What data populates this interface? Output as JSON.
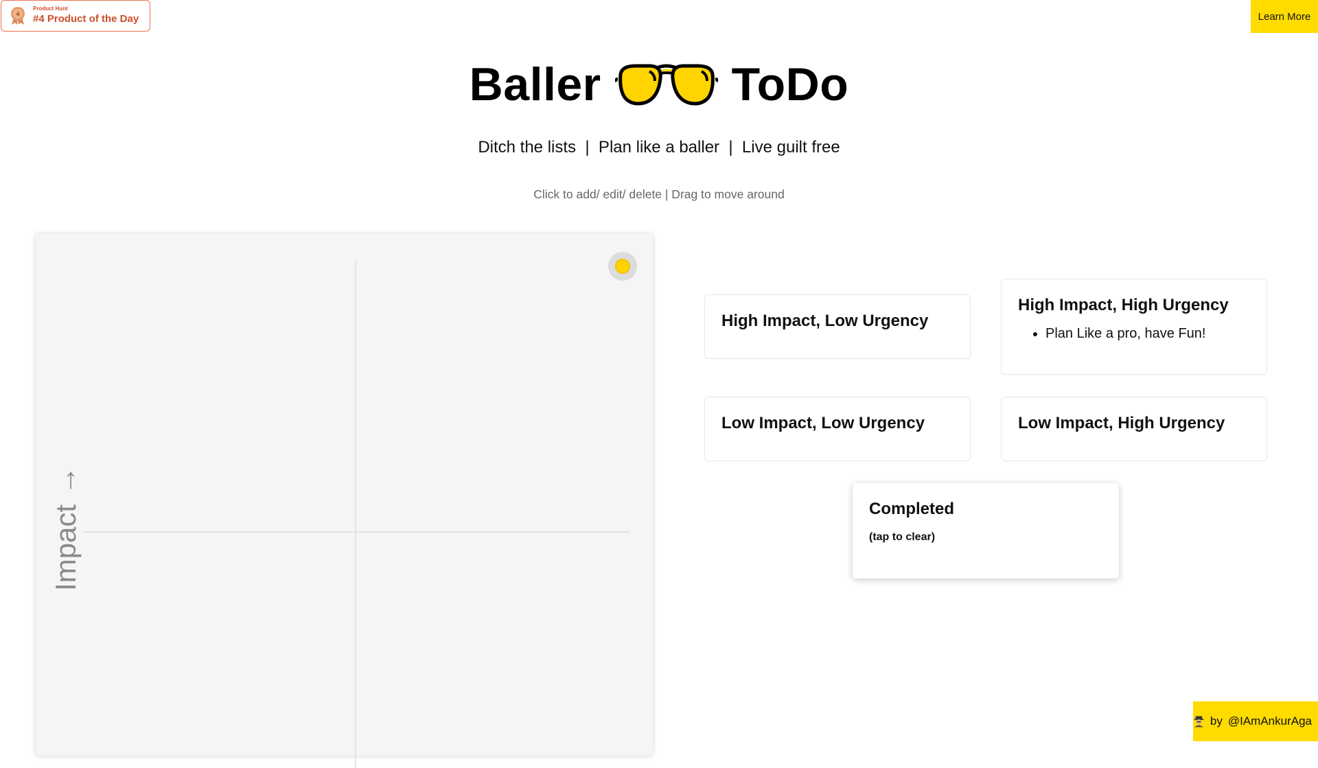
{
  "badge": {
    "small_label": "Product Hunt",
    "big_label": "#4 Product of the Day",
    "medal_number": "4",
    "color": "#cc4d29"
  },
  "header": {
    "learn_more_label": "Learn More",
    "title_left": "Baller",
    "title_right": "ToDo",
    "title_icon": "sunglasses-icon",
    "tagline": "Ditch the lists  |  Plan like a baller  |  Live guilt free",
    "hint": "Click to add/ edit/ delete | Drag to move around"
  },
  "matrix": {
    "axis_label": "Impact",
    "axis_arrow": "→"
  },
  "quadrants": {
    "high_impact_low_urgency": {
      "title": "High Impact, Low Urgency",
      "items": []
    },
    "high_impact_high_urgency": {
      "title": "High Impact, High Urgency",
      "items": [
        "Plan Like a pro, have Fun!"
      ]
    },
    "low_impact_low_urgency": {
      "title": "Low Impact, Low Urgency",
      "items": []
    },
    "low_impact_high_urgency": {
      "title": "Low Impact, High Urgency",
      "items": []
    }
  },
  "completed": {
    "title": "Completed",
    "subtitle": "(tap to clear)"
  },
  "footer": {
    "by_label": "by",
    "handle": "@IAmAnkurAga",
    "icon": "person-icon"
  },
  "colors": {
    "accent_yellow": "#ffdb00",
    "badge_orange": "#cc4d29",
    "matrix_bg": "#f5f5f5"
  }
}
